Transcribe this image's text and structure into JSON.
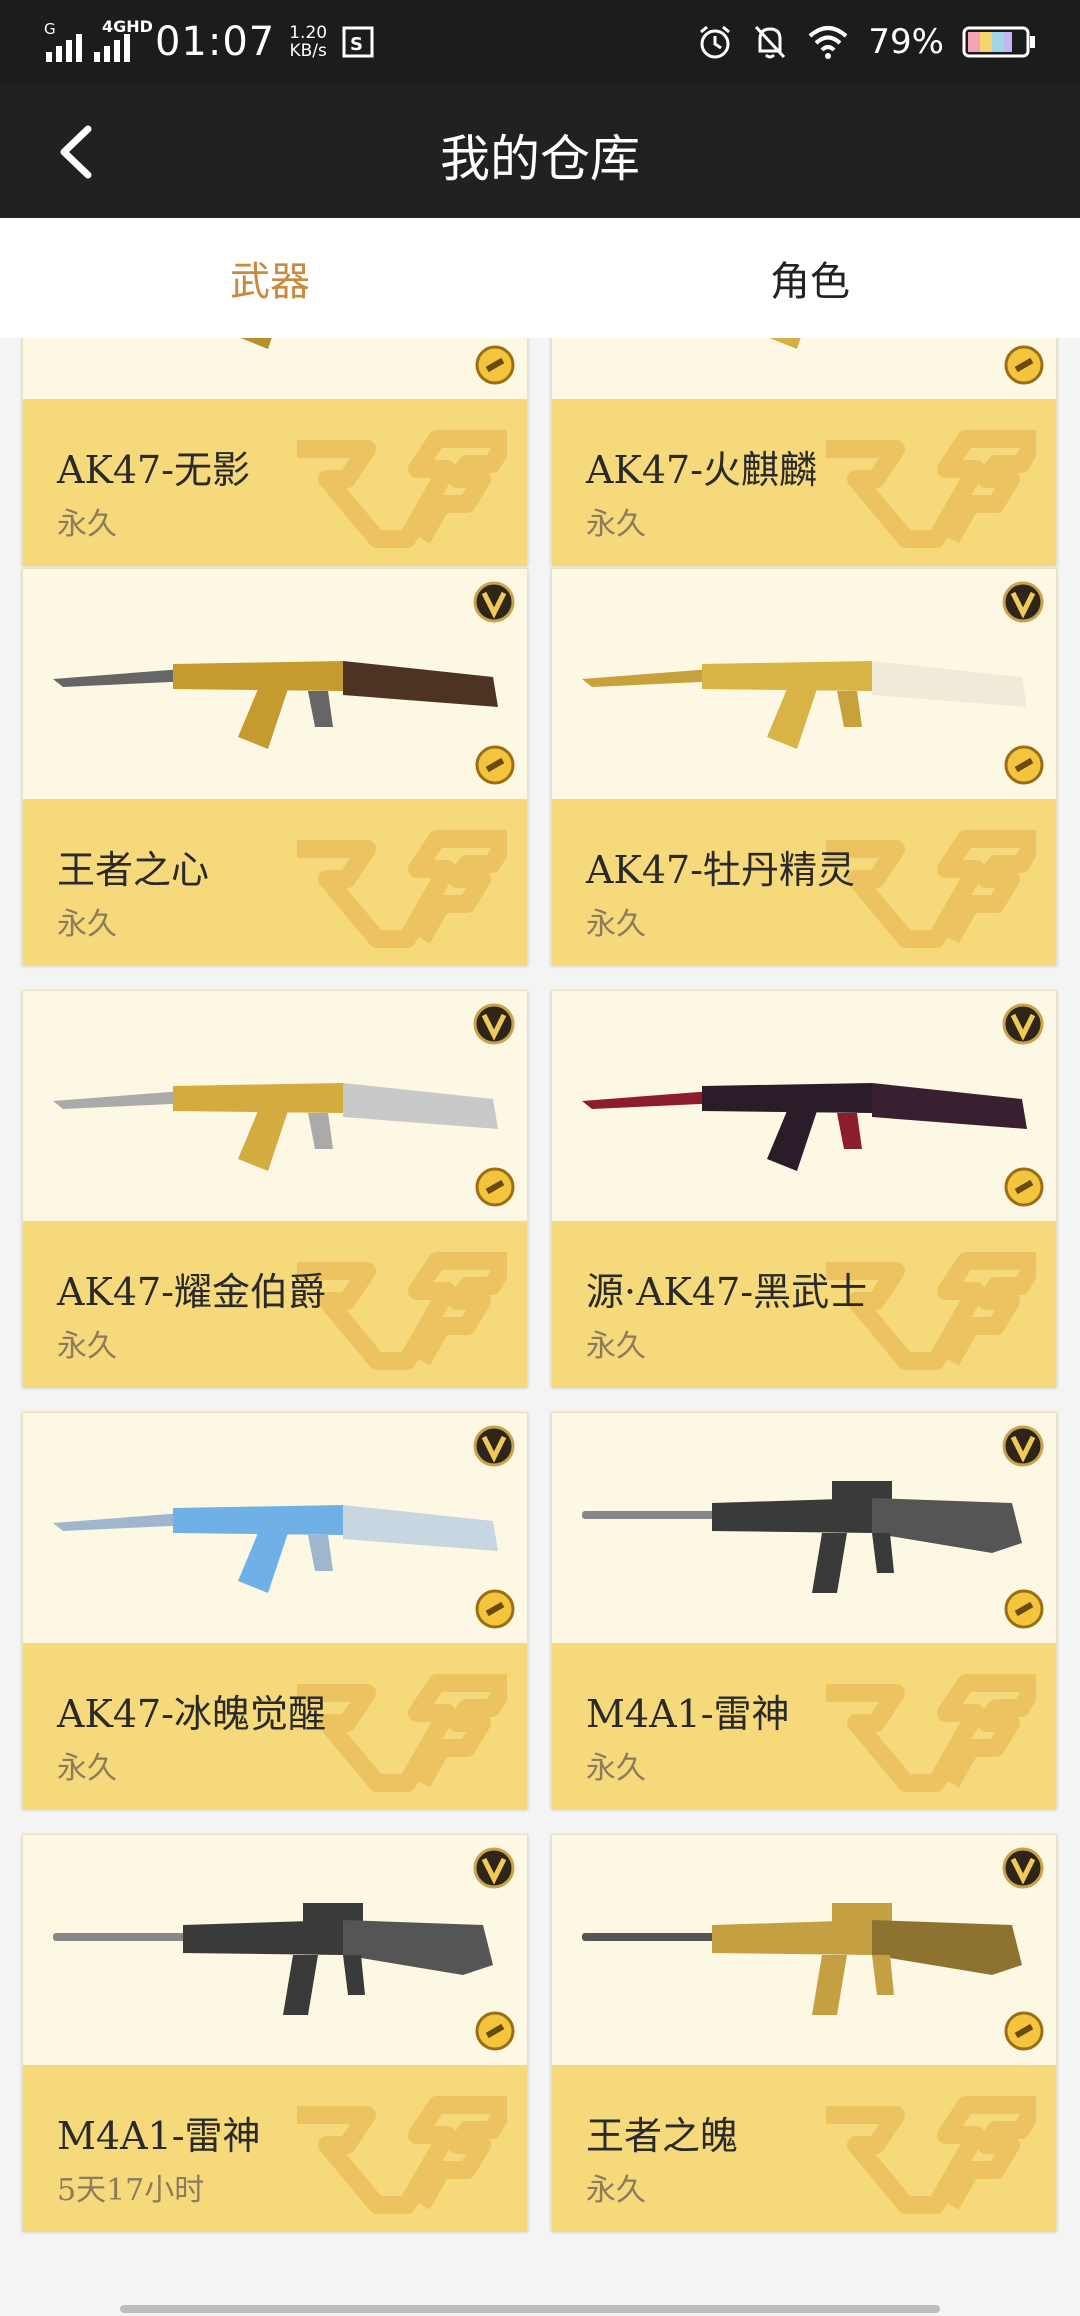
{
  "statusbar": {
    "network": "4GHD",
    "time": "01:07",
    "speed_value": "1.20",
    "speed_unit": "KB/s",
    "battery": "79%"
  },
  "appbar": {
    "title": "我的仓库"
  },
  "tabs": [
    {
      "label": "武器",
      "active": true
    },
    {
      "label": "角色",
      "active": false
    }
  ],
  "items": [
    {
      "name": "AK47-无影",
      "duration": "永久"
    },
    {
      "name": "AK47-火麒麟",
      "duration": "永久"
    },
    {
      "name": "王者之心",
      "duration": "永久"
    },
    {
      "name": "AK47-牡丹精灵",
      "duration": "永久"
    },
    {
      "name": "AK47-耀金伯爵",
      "duration": "永久"
    },
    {
      "name": "源·AK47-黑武士",
      "duration": "永久"
    },
    {
      "name": "AK47-冰魄觉醒",
      "duration": "永久"
    },
    {
      "name": "M4A1-雷神",
      "duration": "永久"
    },
    {
      "name": "M4A1-雷神",
      "duration": "5天17小时"
    },
    {
      "name": "王者之魄",
      "duration": "永久"
    }
  ],
  "colors": {
    "accent": "#c98a3c",
    "card_info_bg": "#f5d97a",
    "card_image_bg": "#fdf8e4",
    "appbar_bg": "#212121"
  }
}
